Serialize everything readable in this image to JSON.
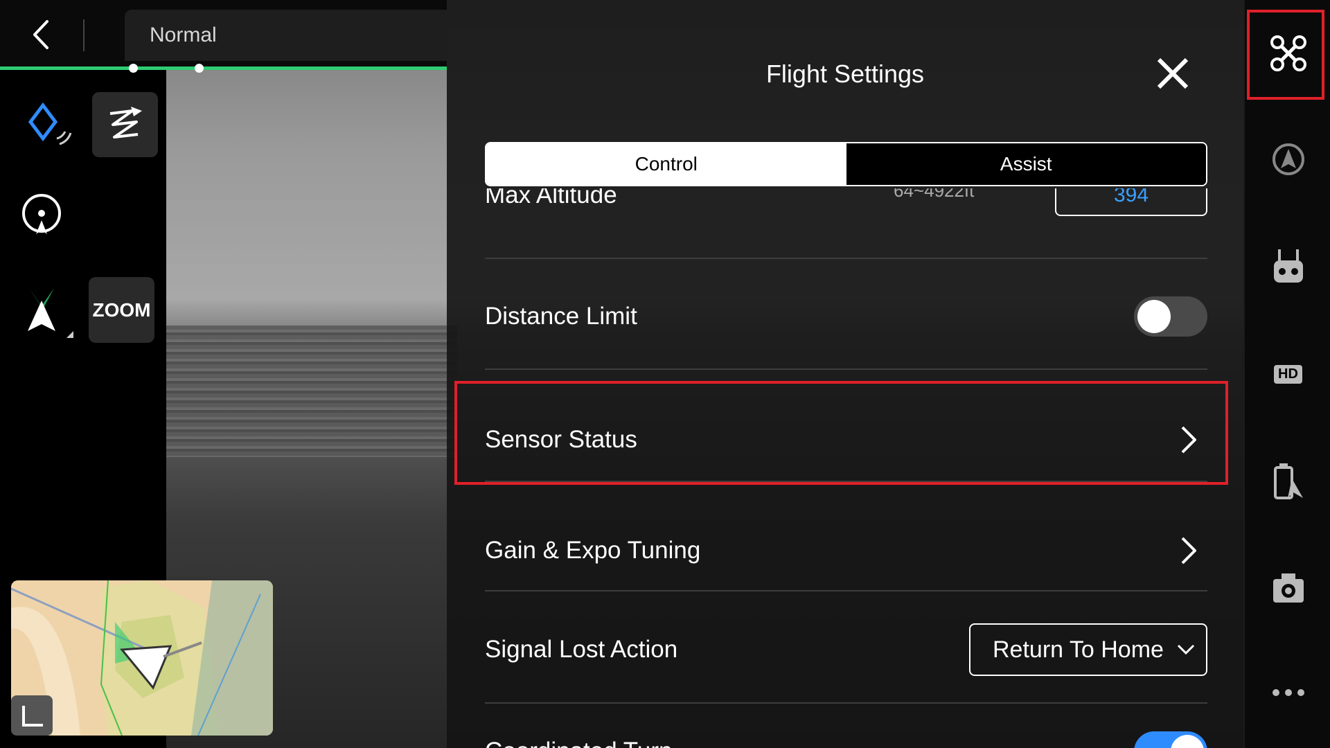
{
  "topbar": {
    "mode_label": "Normal"
  },
  "left_tools": {
    "zoom_label": "ZOOM"
  },
  "panel": {
    "title": "Flight Settings",
    "tabs": [
      {
        "label": "Control",
        "active": true
      },
      {
        "label": "Assist",
        "active": false
      }
    ],
    "rows": {
      "max_altitude": {
        "label": "Max Altitude",
        "range": "64~4922ft",
        "value": "394"
      },
      "distance_limit": {
        "label": "Distance Limit",
        "enabled": false
      },
      "sensor_status": {
        "label": "Sensor Status"
      },
      "gain_expo": {
        "label": "Gain & Expo Tuning"
      },
      "signal_lost": {
        "label": "Signal Lost Action",
        "value": "Return To Home"
      },
      "coordinated_turn": {
        "label": "Coordinated Turn",
        "enabled": true
      }
    }
  },
  "right_sidebar": {
    "icons": [
      "aircraft-icon",
      "obstacle-avoidance-icon",
      "remote-controller-icon",
      "hd-transmission-icon",
      "battery-icon",
      "camera-icon",
      "more-icon"
    ],
    "hd_label": "HD"
  },
  "colors": {
    "accent_green": "#2ecc71",
    "toggle_on": "#2f8cff",
    "highlight_red": "#e0202a",
    "value_blue": "#3aa0ff"
  }
}
